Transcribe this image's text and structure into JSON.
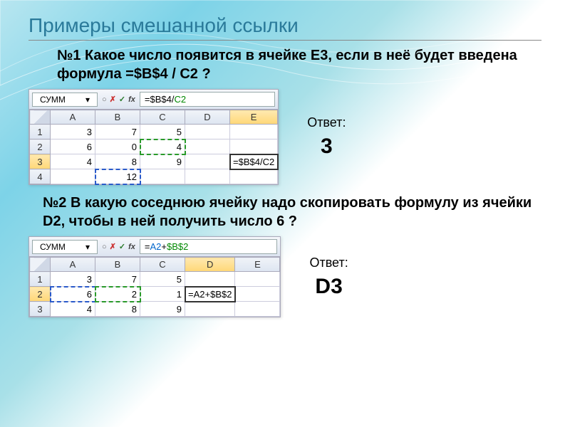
{
  "title": "Примеры смешанной ссылки",
  "q1": {
    "text": "№1 Какое число появится в ячейке  E3, если в неё будет введена формула  =$B$4 / C2 ?",
    "answer_label": "Ответ:",
    "answer_value": "3"
  },
  "q2": {
    "text": "№2 В какую соседнюю ячейку надо скопировать формулу из ячейки D2, чтобы в ней получить число  6 ?",
    "answer_label": "Ответ:",
    "answer_value": "D3"
  },
  "excel1": {
    "namebox": "СУММ",
    "formula_plain": "=$B$4/C2",
    "formula_tok1": "=$B$4",
    "formula_tok2": "/",
    "formula_tok3": "C2",
    "cols": [
      "A",
      "B",
      "C",
      "D",
      "E"
    ],
    "rows": [
      "1",
      "2",
      "3",
      "4"
    ],
    "cells": {
      "r1": [
        "3",
        "7",
        "5",
        "",
        ""
      ],
      "r2": [
        "6",
        "0",
        "4",
        "",
        ""
      ],
      "r3": [
        "4",
        "8",
        "9",
        "",
        "=$B$4/C2"
      ],
      "r4": [
        "",
        "12",
        "",
        "",
        ""
      ]
    }
  },
  "excel2": {
    "namebox": "СУММ",
    "formula_plain": "=A2+$B$2",
    "formula_tok1": "=",
    "formula_tok2": "A2",
    "formula_tok3": "+",
    "formula_tok4": "$B$2",
    "cols": [
      "A",
      "B",
      "C",
      "D",
      "E"
    ],
    "rows": [
      "1",
      "2",
      "3"
    ],
    "cells": {
      "r1": [
        "3",
        "7",
        "5",
        "",
        ""
      ],
      "r2": [
        "6",
        "2",
        "1",
        "=A2+$B$2",
        ""
      ],
      "r3": [
        "4",
        "8",
        "9",
        "",
        ""
      ]
    }
  },
  "fx": {
    "x": "✗",
    "v": "✓",
    "label": "fx",
    "dd": "▾",
    "circ": "○"
  }
}
